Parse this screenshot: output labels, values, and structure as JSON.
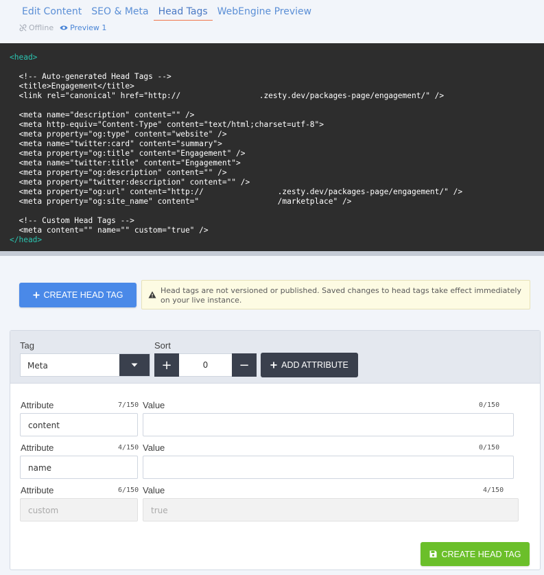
{
  "tabs": [
    {
      "label": "Edit Content"
    },
    {
      "label": "SEO & Meta"
    },
    {
      "label": "Head Tags"
    },
    {
      "label": "WebEngine Preview"
    }
  ],
  "status": {
    "offline": "Offline",
    "preview": "Preview 1"
  },
  "code_lines": {
    "l01": "<head>",
    "l02": "",
    "l03": "  <!-- Auto-generated Head Tags -->",
    "l04": "  <title>Engagement</title>",
    "l05": "  <link rel=\"canonical\" href=\"http://                 .zesty.dev/packages-page/engagement/\" />",
    "l06": "",
    "l07": "  <meta name=\"description\" content=\"\" />",
    "l08": "  <meta http-equiv=\"Content-Type\" content=\"text/html;charset=utf-8\">",
    "l09": "  <meta property=\"og:type\" content=\"website\" />",
    "l10": "  <meta name=\"twitter:card\" content=\"summary\">",
    "l11": "  <meta property=\"og:title\" content=\"Engagement\" />",
    "l12": "  <meta name=\"twitter:title\" content=\"Engagement\">",
    "l13": "  <meta property=\"og:description\" content=\"\" />",
    "l14": "  <meta property=\"twitter:description\" content=\"\" />",
    "l15": "  <meta property=\"og:url\" content=\"http://                .zesty.dev/packages-page/engagement/\" />",
    "l16": "  <meta property=\"og:site_name\" content=\"                 /marketplace\" />",
    "l17": "",
    "l18": "  <!-- Custom Head Tags -->",
    "l19": "  <meta content=\"\" name=\"\" custom=\"true\" />",
    "l20": "</head>"
  },
  "create_button": {
    "label": "CREATE HEAD TAG"
  },
  "warning": {
    "text": "Head tags are not versioned or published. Saved changes to head tags take effect immediately on your live instance."
  },
  "editor": {
    "tag_label": "Tag",
    "tag_value": "Meta",
    "sort_label": "Sort",
    "sort_value": "0",
    "sort_plus": "+",
    "sort_minus": "−",
    "add_attribute_label": "ADD ATTRIBUTE",
    "rows": [
      {
        "attr_label": "Attribute",
        "attr_count": "7/150",
        "attr_value": "content",
        "value_label": "Value",
        "value_count": "0/150",
        "value_value": ""
      },
      {
        "attr_label": "Attribute",
        "attr_count": "4/150",
        "attr_value": "name",
        "value_label": "Value",
        "value_count": "0/150",
        "value_value": ""
      },
      {
        "attr_label": "Attribute",
        "attr_count": "6/150",
        "attr_value": "custom",
        "value_label": "Value",
        "value_count": "4/150",
        "value_value": "true"
      }
    ],
    "save_label": "CREATE HEAD TAG"
  },
  "colors": {
    "accent": "#4a89e8",
    "code_bg": "#2d2d2d",
    "code_tag": "#2bc4b0",
    "save_green": "#6bbf2a",
    "dark_button": "#3a404d",
    "active_tab_underline": "#f0744a"
  },
  "icons": {
    "offline": "unlink-icon",
    "preview": "eye-icon",
    "create": "plus-icon",
    "warning": "warning-triangle-icon",
    "caret": "chevron-down-icon",
    "save": "floppy-disk-icon"
  }
}
